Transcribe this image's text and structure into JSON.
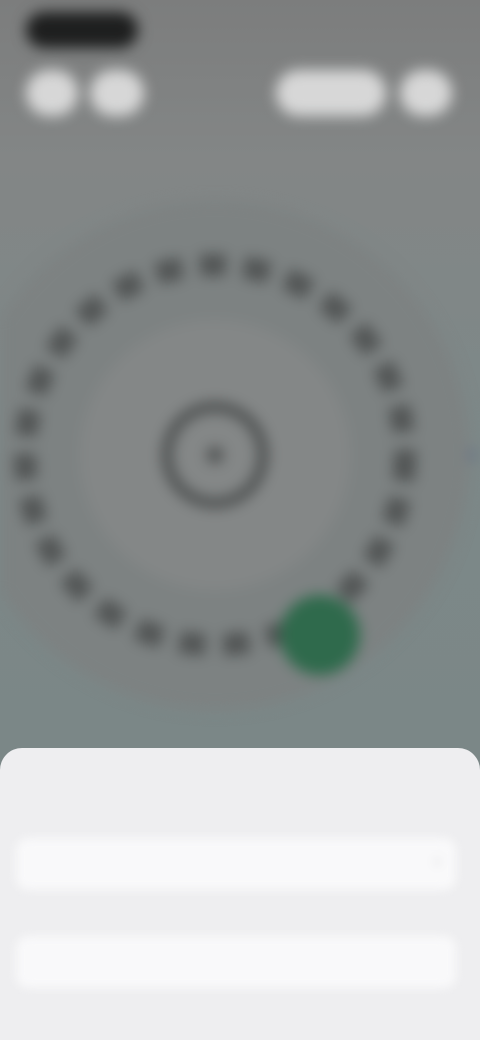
{
  "status_bar": {
    "time_label": ""
  },
  "top_bar": {
    "left_buttons": [
      "",
      ""
    ],
    "right_buttons": [
      "",
      ""
    ]
  },
  "dial": {
    "indicator_color": "#2f6a4c",
    "spoke_color": "#4d5c86",
    "icon": "compass-dial-icon"
  },
  "sheet": {
    "field_1": {
      "label": "",
      "value": ""
    },
    "field_2": {
      "label": "",
      "value": ""
    }
  }
}
